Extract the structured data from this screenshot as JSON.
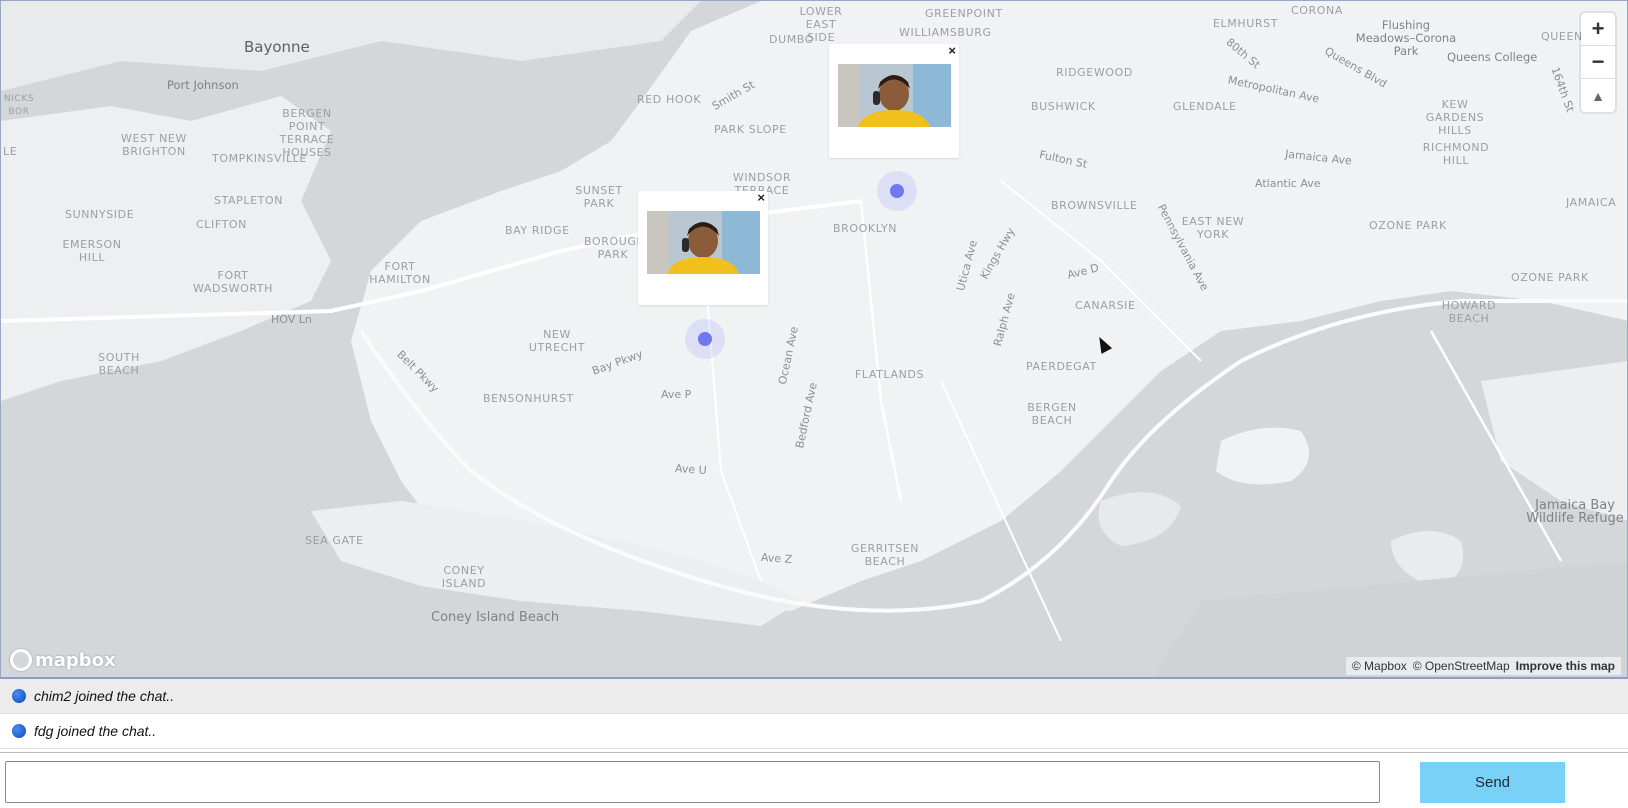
{
  "map": {
    "zoom_in_label": "+",
    "zoom_out_label": "−",
    "compass_label": "▲",
    "logo_text": "mapbox",
    "attribution": {
      "mapbox": "© Mapbox",
      "osm": "© OpenStreetMap",
      "improve": "Improve this map"
    },
    "places": {
      "bayonne": "Bayonne",
      "port_johnson": "Port Johnson",
      "lower_east_side": "LOWER EAST SIDE",
      "greenpoint": "GREENPOINT",
      "williamsburg": "WILLIAMSBURG",
      "dumbo": "DUMBO",
      "elmhurst": "ELMHURST",
      "corona": "CORONA",
      "flushing": "Flushing Meadows–Corona Park",
      "queens_college": "Queens College",
      "queens": "QUEENS",
      "ridgewood": "RIDGEWOOD",
      "bushwick": "BUSHWICK",
      "glendale": "GLENDALE",
      "kew_gardens": "KEW GARDENS HILLS",
      "richmond_hill": "RICHMOND HILL",
      "jamaica": "JAMAICA",
      "red_hook": "RED HOOK",
      "park_slope": "PARK SLOPE",
      "bergen_point": "BERGEN POINT TERRACE HOUSES",
      "west_new_brighton": "WEST NEW BRIGHTON",
      "tompkinsville": "TOMPKINSVILLE",
      "stapleton": "STAPLETON",
      "clifton": "CLIFTON",
      "sunnyside": "SUNNYSIDE",
      "emerson_hill": "EMERSON HILL",
      "fort_wadsworth": "FORT WADSWORTH",
      "south_beach": "SOUTH BEACH",
      "windsor_terrace": "WINDSOR TERRACE",
      "sunset_park": "SUNSET PARK",
      "bay_ridge": "BAY RIDGE",
      "borough_park": "BOROUGH PARK",
      "fort_hamilton": "FORT HAMILTON",
      "brooklyn": "BROOKLYN",
      "brownsville": "BROWNSVILLE",
      "east_new_york": "EAST NEW YORK",
      "ozone_park": "OZONE PARK",
      "ozone_park_2": "OZONE PARK",
      "howard_beach": "HOWARD BEACH",
      "canarsie": "CANARSIE",
      "paerdegat": "PAERDEGAT",
      "flatlands": "FLATLANDS",
      "new_utrecht": "NEW UTRECHT",
      "bensonhurst": "BENSONHURST",
      "bergen_beach": "BERGEN BEACH",
      "sea_gate": "SEA GATE",
      "coney_island": "CONEY ISLAND",
      "coney_island_beach": "Coney Island Beach",
      "gerritsen_beach": "GERRITSEN BEACH",
      "jamaica_bay": "Jamaica Bay Wildlife Refuge",
      "road_smith": "Smith St",
      "road_fulton": "Fulton St",
      "road_jamaica": "Jamaica Ave",
      "road_atlantic": "Atlantic Ave",
      "road_metropolitan": "Metropolitan Ave",
      "road_queens": "Queens Blvd",
      "road_80": "80th St",
      "road_164": "164th St",
      "road_utica": "Utica Ave",
      "road_kings": "Kings Hwy",
      "road_ave_d": "Ave D",
      "road_pennsylvania": "Pennsylvania Ave",
      "road_ralph": "Ralph Ave",
      "road_hov": "HOV Ln",
      "road_belt": "Belt Pkwy",
      "road_bay": "Bay Pkwy",
      "road_ave_p": "Ave P",
      "road_ocean": "Ocean Ave",
      "road_bedford": "Bedford Ave",
      "road_ave_u": "Ave U",
      "road_ave_z": "Ave Z",
      "nicks": "NICKS BOR",
      "le": "LE"
    },
    "popups": [
      {
        "close_label": "×"
      },
      {
        "close_label": "×"
      }
    ]
  },
  "chat": {
    "messages": [
      {
        "text": "chim2 joined the chat.."
      },
      {
        "text": "fdg joined the chat.."
      }
    ]
  },
  "composer": {
    "input_value": "",
    "input_placeholder": "",
    "send_label": "Send"
  },
  "colors": {
    "send_button": "#79d1f7",
    "marker": "#6f78f0",
    "land": "#f1f2f3",
    "water": "#d3d6d9"
  }
}
